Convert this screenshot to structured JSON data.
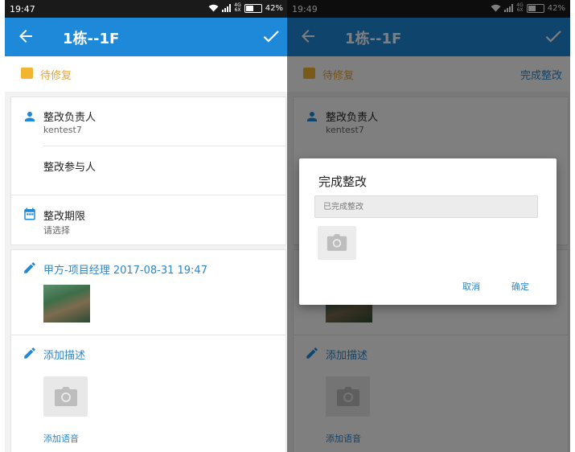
{
  "screen_left": {
    "status_bar": {
      "time": "19:47",
      "battery": "42%",
      "network_top": "4G",
      "network_bottom": "6X"
    },
    "app_bar": {
      "title": "1栋--1F"
    },
    "status_label": "待修复",
    "responsible_label": "整改负责人",
    "responsible_value": "kentest7",
    "participants_label": "整改参与人",
    "deadline_label": "整改期限",
    "deadline_value": "请选择",
    "log_entry": "甲方-项目经理 2017-08-31 19:47",
    "add_description": "添加描述",
    "add_voice": "添加语音"
  },
  "screen_right": {
    "status_bar": {
      "time": "19:49",
      "battery": "42%",
      "network_top": "4G",
      "network_bottom": "6X"
    },
    "app_bar": {
      "title": "1栋--1F"
    },
    "status_label": "待修复",
    "complete_link": "完成整改",
    "responsible_label": "整改负责人",
    "responsible_value": "kentest7",
    "add_description": "添加描述",
    "add_voice": "添加语音",
    "dialog": {
      "title": "完成整改",
      "input_placeholder": "已完成整改",
      "cancel_label": "取消",
      "confirm_label": "确定"
    }
  },
  "colors": {
    "app_bar": "#1e88d9",
    "accent_blue": "#2e86c9",
    "status_orange": "#f3b430",
    "status_text": "#e7a43a"
  },
  "icons": [
    "back-arrow-icon",
    "check-icon",
    "person-icon",
    "calendar-icon",
    "pencil-icon",
    "camera-icon",
    "wifi-icon",
    "signal-icon",
    "battery-icon"
  ]
}
